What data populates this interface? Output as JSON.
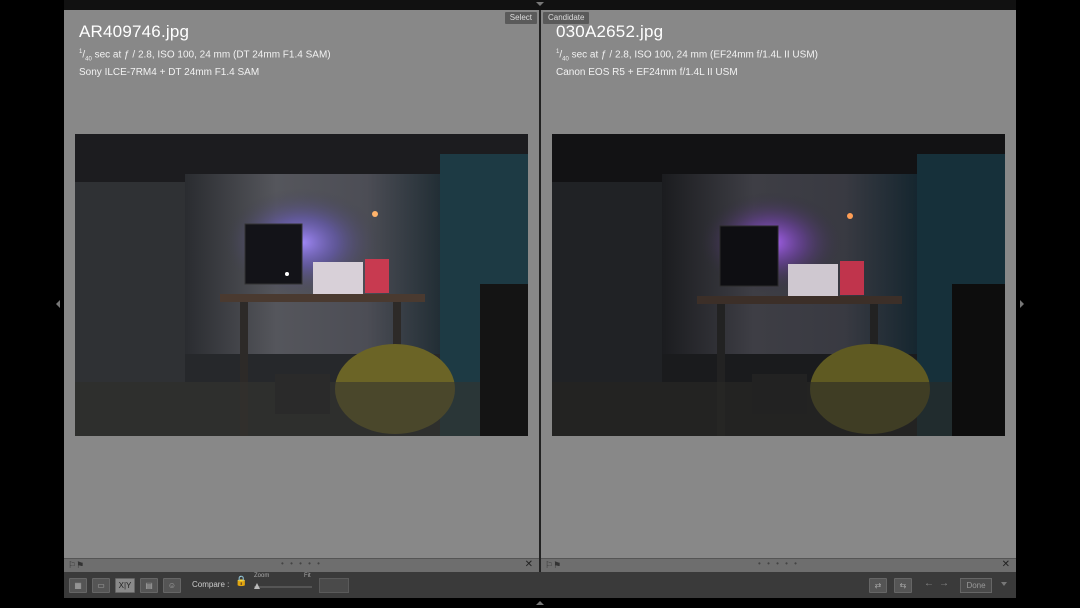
{
  "panels": {
    "left": {
      "tag": "Select",
      "filename": "AR409746.jpg",
      "exif_line1": "sec at ƒ / 2.8, ISO 100, 24 mm (DT 24mm F1.4 SAM)",
      "camera": "Sony ILCE-7RM4 + DT 24mm F1.4 SAM"
    },
    "right": {
      "tag": "Candidate",
      "filename": "030A2652.jpg",
      "exif_line1": "sec at ƒ / 2.8, ISO 100, 24 mm (EF24mm f/1.4L II USM)",
      "camera": "Canon EOS R5 + EF24mm f/1.4L II USM"
    },
    "shutter_num": "1",
    "shutter_den": "40"
  },
  "toolbar": {
    "compare_label": "Compare :",
    "zoom_label": "Zoom",
    "fit_label": "Fit",
    "done_label": "Done",
    "xy_label": "X|Y",
    "zoom_level": 0.05
  },
  "colors": {
    "panel_bg": "#888888",
    "toolbar_bg": "#3a3a3a",
    "lock_accent": "#c9a800"
  }
}
